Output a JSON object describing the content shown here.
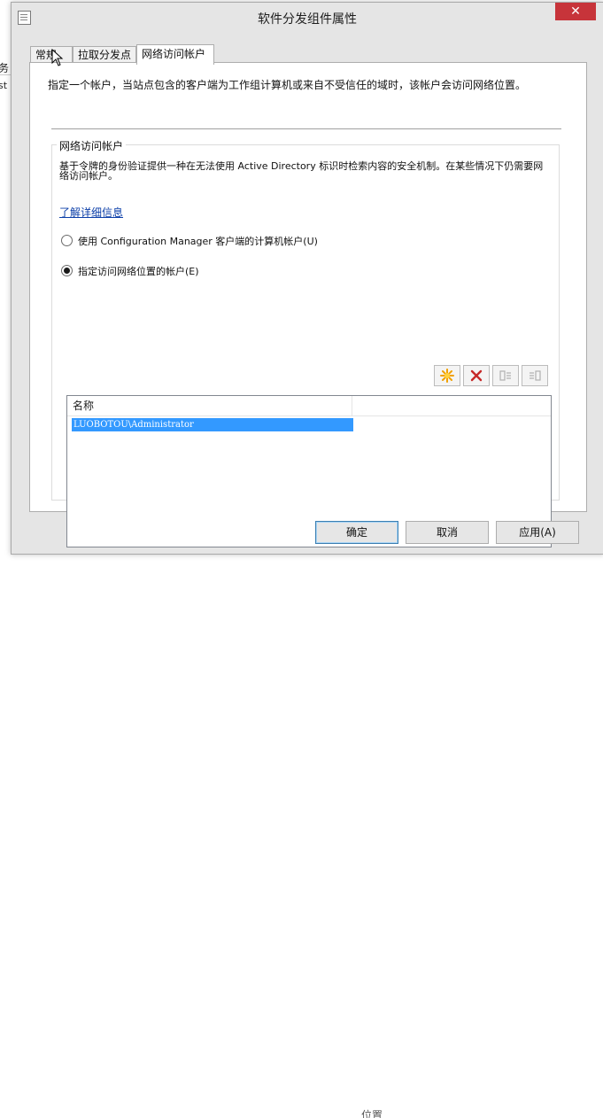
{
  "background": {
    "left_text_1": "务",
    "left_text_2": "st",
    "bottom_text": "位置"
  },
  "window": {
    "title": "软件分发组件属性",
    "close_glyph": "✕"
  },
  "tabs": [
    {
      "label": "常规"
    },
    {
      "label": "拉取分发点"
    },
    {
      "label": "网络访问帐户"
    }
  ],
  "page": {
    "description": "指定一个帐户，当站点包含的客户端为工作组计算机或来自不受信任的域时，该帐户会访问网络位置。",
    "group": {
      "title": "网络访问帐户",
      "text": "基于令牌的身份验证提供一种在无法使用 Active Directory 标识时检索内容的安全机制。在某些情况下仍需要网络访问帐户。",
      "link": "了解详细信息",
      "radio_computer_account": "使用 Configuration Manager 客户端的计算机帐户(U)",
      "radio_specify_account": "指定访问网络位置的帐户(E)"
    },
    "toolbar": {
      "new_icon": "new-star-icon",
      "delete_icon": "delete-x-icon",
      "edit_icon": "edit-icon",
      "set_icon": "set-icon"
    },
    "list": {
      "column_name": "名称",
      "rows": [
        "LUOBOTOU\\Administrator"
      ]
    }
  },
  "footer": {
    "ok": "确定",
    "cancel": "取消",
    "apply": "应用(A)"
  },
  "colors": {
    "selection": "#3399ff",
    "close": "#c7343a",
    "link": "#0b3ea8"
  }
}
